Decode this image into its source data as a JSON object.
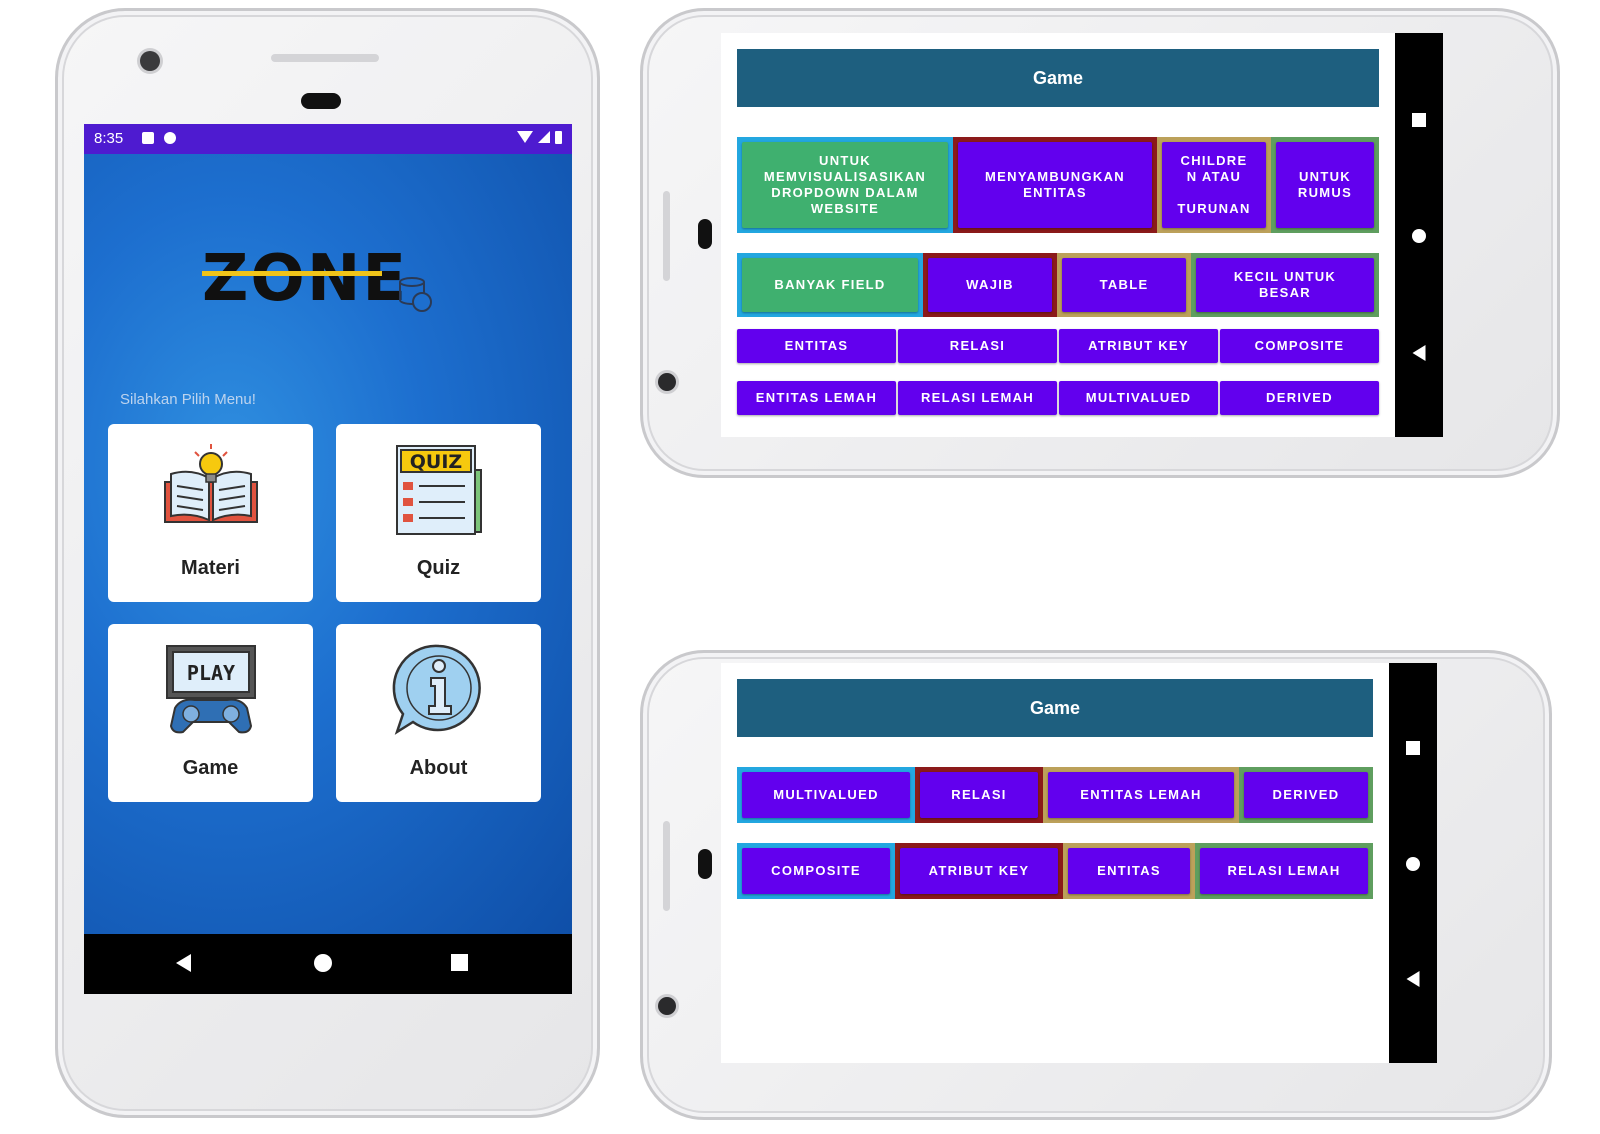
{
  "portrait": {
    "status_time": "8:35",
    "logo_text": "ZONE",
    "subtitle": "Silahkan Pilih Menu!",
    "menu": [
      {
        "label": "Materi",
        "icon": "open-book-lightbulb-icon"
      },
      {
        "label": "Quiz",
        "icon": "quiz-document-icon"
      },
      {
        "label": "Game",
        "icon": "play-gamepad-icon"
      },
      {
        "label": "About",
        "icon": "info-bubble-icon"
      }
    ],
    "colors": {
      "status_bar": "#4e1bd0",
      "background": "#1d6fcf",
      "card": "#ffffff"
    }
  },
  "game1": {
    "title": "Game",
    "row1": [
      {
        "label": "UNTUK\nMEMVISUALISASIKAN\nDROPDOWN DALAM\nWEBSITE",
        "bg": "#23a7e0",
        "btn": "green"
      },
      {
        "label": "MENYAMBUNGKAN\nENTITAS",
        "bg": "#8b1a1a",
        "btn": "purple"
      },
      {
        "label": "CHILDRE\nN ATAU\n\nTURUNAN",
        "bg": "#bca15a",
        "btn": "purple"
      },
      {
        "label": "UNTUK\nRUMUS",
        "bg": "#5f9e5f",
        "btn": "purple"
      }
    ],
    "row2": [
      {
        "label": "BANYAK FIELD",
        "bg": "#23a7e0",
        "btn": "green"
      },
      {
        "label": "WAJIB",
        "bg": "#8b1a1a",
        "btn": "purple"
      },
      {
        "label": "TABLE",
        "bg": "#bca15a",
        "btn": "purple"
      },
      {
        "label": "KECIL UNTUK\nBESAR",
        "bg": "#5f9e5f",
        "btn": "purple"
      }
    ],
    "row3": [
      "ENTITAS",
      "RELASI",
      "ATRIBUT KEY",
      "COMPOSITE"
    ],
    "row4": [
      "ENTITAS LEMAH",
      "RELASI LEMAH",
      "MULTIVALUED",
      "DERIVED"
    ],
    "colors": {
      "title_bar": "#1e5f7f",
      "button": "#6200ee"
    }
  },
  "game2": {
    "title": "Game",
    "row1": [
      {
        "label": "MULTIVALUED",
        "bg": "#23a7e0"
      },
      {
        "label": "RELASI",
        "bg": "#8b1a1a"
      },
      {
        "label": "ENTITAS LEMAH",
        "bg": "#bca15a"
      },
      {
        "label": "DERIVED",
        "bg": "#5f9e5f"
      }
    ],
    "row2": [
      {
        "label": "COMPOSITE",
        "bg": "#23a7e0"
      },
      {
        "label": "ATRIBUT KEY",
        "bg": "#8b1a1a"
      },
      {
        "label": "ENTITAS",
        "bg": "#bca15a"
      },
      {
        "label": "RELASI LEMAH",
        "bg": "#5f9e5f"
      }
    ]
  }
}
